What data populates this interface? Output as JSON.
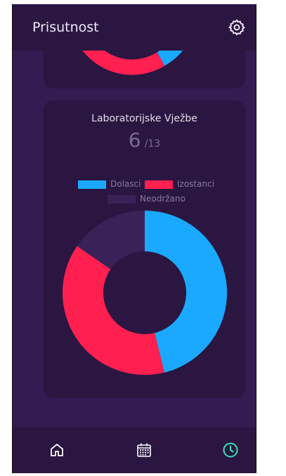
{
  "appbar": {
    "title": "Prisutnost",
    "settings_icon": "gear-icon"
  },
  "colors": {
    "present": "#1aa9ff",
    "absent": "#ff2050",
    "not_held": "#3a2258",
    "accent": "#36e2b4"
  },
  "cards": [
    {
      "title": "Laboratorijske Vježbe",
      "count": "6",
      "total": "/13",
      "legend": [
        {
          "label": "Dolasci"
        },
        {
          "label": "Izostanci"
        },
        {
          "label": "Neodržano"
        }
      ],
      "chart_data": {
        "type": "pie",
        "categories": [
          "Dolasci",
          "Izostanci",
          "Neodržano"
        ],
        "values": [
          6,
          5,
          2
        ]
      }
    }
  ],
  "bottom_nav": [
    {
      "icon": "home-icon",
      "active": false
    },
    {
      "icon": "calendar-icon",
      "active": false
    },
    {
      "icon": "clock-icon",
      "active": true
    }
  ]
}
